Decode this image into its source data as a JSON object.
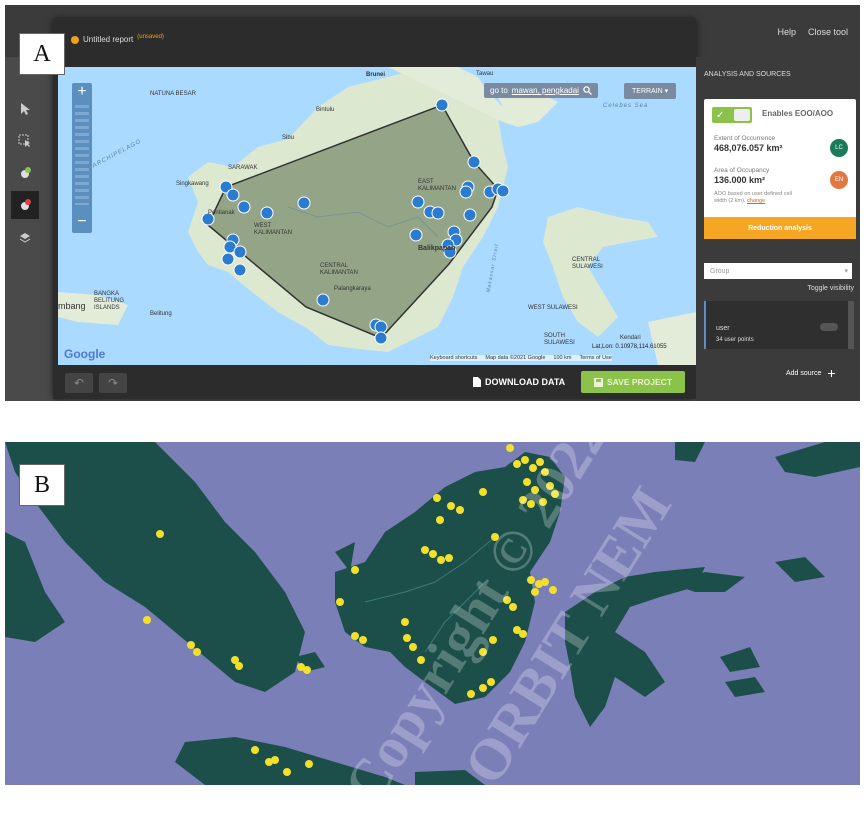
{
  "panel_a": {
    "label": "A",
    "report": {
      "title": "Untitled report",
      "status": "(unsaved)"
    },
    "top_links": [
      "Help",
      "Close tool"
    ],
    "search": {
      "prefix": "go to",
      "query": "mawan, pengkadai"
    },
    "map_type_button": "TERRAIN",
    "zoom_in": "+",
    "zoom_out": "−",
    "latlng": "Lat,Lon: 0.10978,114.61055",
    "map_footer": [
      "Keyboard shortcuts",
      "Map data ©2021 Google",
      "100 km",
      "Terms of Use"
    ],
    "google_logo": "Google",
    "map_labels": {
      "brunei": "Brunei",
      "tawau": "Tawau",
      "natuna": "NATUNA BESAR",
      "archipelago": "ARCHIPELAGO",
      "celebes": "Celebes Sea",
      "bintulu": "Bintulu",
      "sibu": "Sibu",
      "singkawang": "Singkawang",
      "sarawak": "SARAWAK",
      "pontianak": "Pontianak",
      "west_kalimantan": "WEST KALIMANTAN",
      "central_kalimantan": "CENTRAL KALIMANTAN",
      "palangkaraya": "Palangkaraya",
      "bangka": "BANGKA BELITUNG ISLANDS",
      "belitung": "Belitung",
      "mbang": "mbang",
      "balikpapan": "Balikpapan",
      "central_sulawesi": "CENTRAL SULAWESI",
      "west_sulawesi": "WEST SULAWESI",
      "south_sulawesi": "SOUTH SULAWESI",
      "kendari": "Kendari",
      "makassar": "Makassar Strait",
      "east_kalimantan": "EAST KALIMANTAN"
    },
    "sidebar": {
      "title": "ANALYSIS AND SOURCES",
      "toggle_label": "Enables EOO/AOO",
      "eoo_label": "Extent of Occurrence",
      "eoo_value": "468,076.057 km²",
      "eoo_badge": "LC",
      "aoo_label": "Area of Occupancy",
      "aoo_value": "136.000 km²",
      "aoo_note": "AOO based on user defined cell width (2 km).",
      "aoo_note_link": "change",
      "aoo_badge": "EN",
      "reduction_button": "Reduction analysis",
      "group_placeholder": "Group",
      "toggle_visibility": "Toggle visibility",
      "source_name": "user",
      "source_count": "34 user points",
      "add_source": "Add source"
    },
    "download_button": "DOWNLOAD DATA",
    "save_button": "SAVE PROJECT",
    "colors": {
      "accent_green": "#8bc34a",
      "accent_orange": "#f5a623",
      "point_blue": "#2b7bd0",
      "badge_lc": "#1a7a5a",
      "badge_en": "#e07840"
    }
  },
  "panel_b": {
    "label": "B",
    "colors": {
      "sea": "#7b7fb8",
      "land": "#1d4f4a",
      "points": "#f2e02a"
    }
  },
  "watermark": {
    "line1": "Copyright © 2022",
    "line2": "ORBIT NEM"
  }
}
